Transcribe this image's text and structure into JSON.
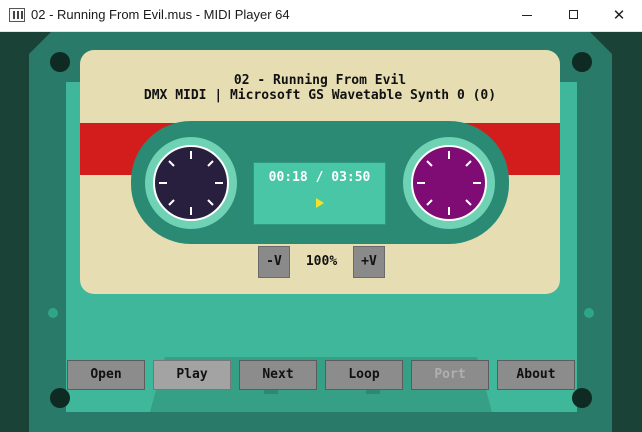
{
  "window": {
    "title": "02 - Running From Evil.mus - MIDI Player 64",
    "icon": "midi-keyboard-icon",
    "controls": {
      "minimize": "minimize-icon",
      "maximize": "maximize-icon",
      "close": "✕"
    }
  },
  "label": {
    "title": "02 - Running From Evil",
    "subtitle": "DMX MIDI | Microsoft GS Wavetable Synth 0 (0)"
  },
  "display": {
    "time": "00:18 / 03:50",
    "state_icon": "play-indicator-icon"
  },
  "volume": {
    "down_label": "-V",
    "level": "100%",
    "up_label": "+V"
  },
  "controls": {
    "open": "Open",
    "play": "Play",
    "next": "Next",
    "loop": "Loop",
    "port": "Port",
    "about": "About"
  },
  "colors": {
    "shell": "#2a7a69",
    "label": "#e6ddb3",
    "stripe": "#d31c1c",
    "reel_left": "#281f3f",
    "reel_right": "#7e0c74",
    "play_indicator": "#f3e22a"
  }
}
